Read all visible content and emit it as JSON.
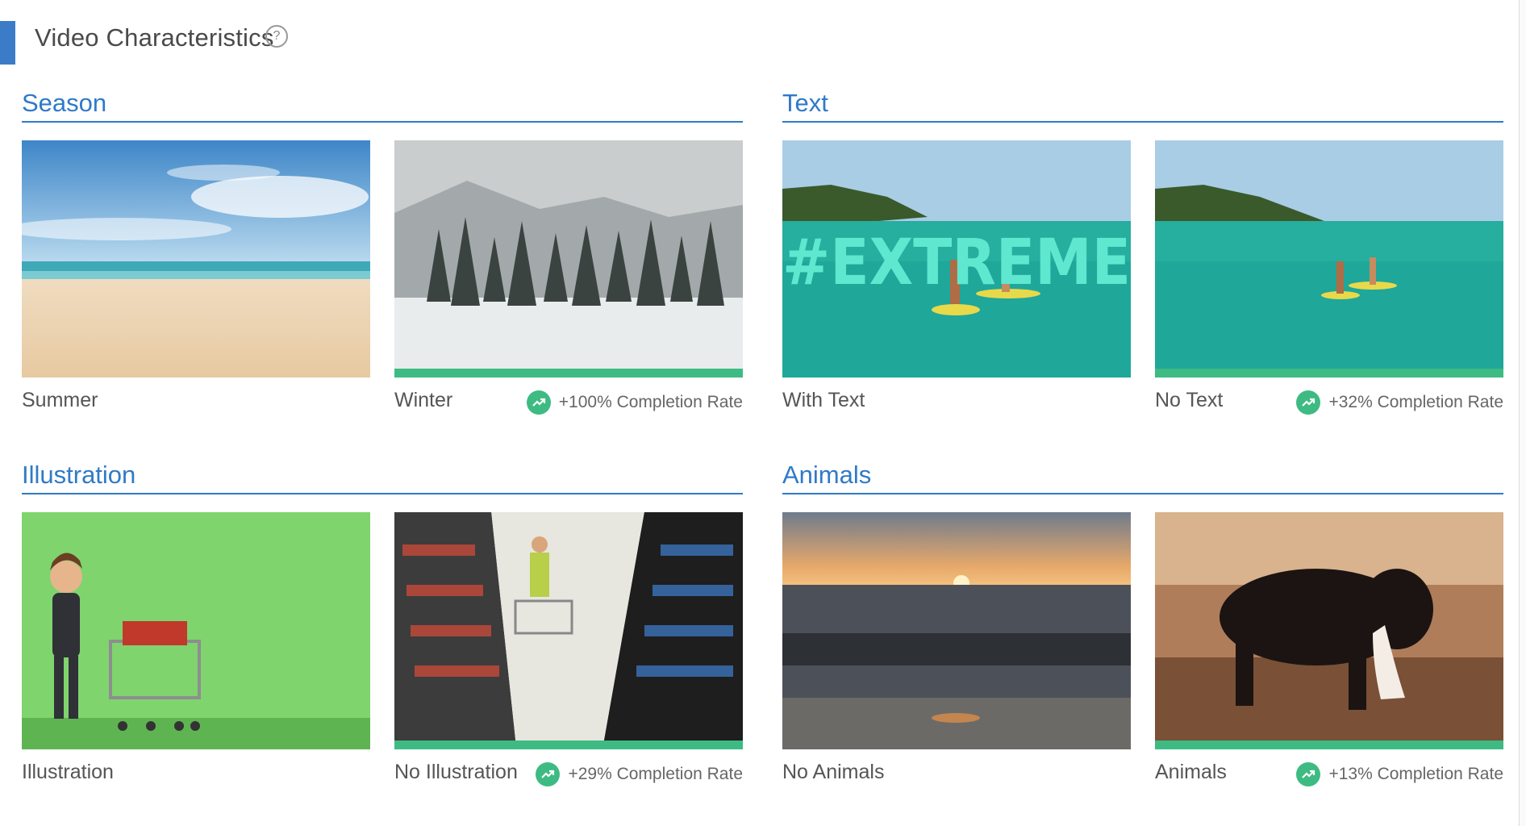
{
  "header": {
    "title": "Video Characteristics",
    "help_glyph": "?"
  },
  "sections": [
    {
      "title": "Season",
      "tiles": [
        {
          "label": "Summer",
          "rate": ""
        },
        {
          "label": "Winter",
          "rate": "+100% Completion Rate"
        }
      ]
    },
    {
      "title": "Text",
      "tiles": [
        {
          "label": "With Text",
          "overlay_text": "#EXTREME",
          "rate": ""
        },
        {
          "label": "No Text",
          "rate": "+32% Completion Rate"
        }
      ]
    },
    {
      "title": "Illustration",
      "tiles": [
        {
          "label": "Illustration",
          "rate": ""
        },
        {
          "label": "No Illustration",
          "rate": "+29% Completion Rate"
        }
      ]
    },
    {
      "title": "Animals",
      "tiles": [
        {
          "label": "No Animals",
          "rate": ""
        },
        {
          "label": "Animals",
          "rate": "+13% Completion Rate"
        }
      ]
    }
  ],
  "colors": {
    "accent": "#3b7bc8",
    "section_title": "#2f7ac8",
    "success": "#3dbb83"
  },
  "icons": {
    "help": "question-circle-icon",
    "rate": "trending-up-icon"
  }
}
